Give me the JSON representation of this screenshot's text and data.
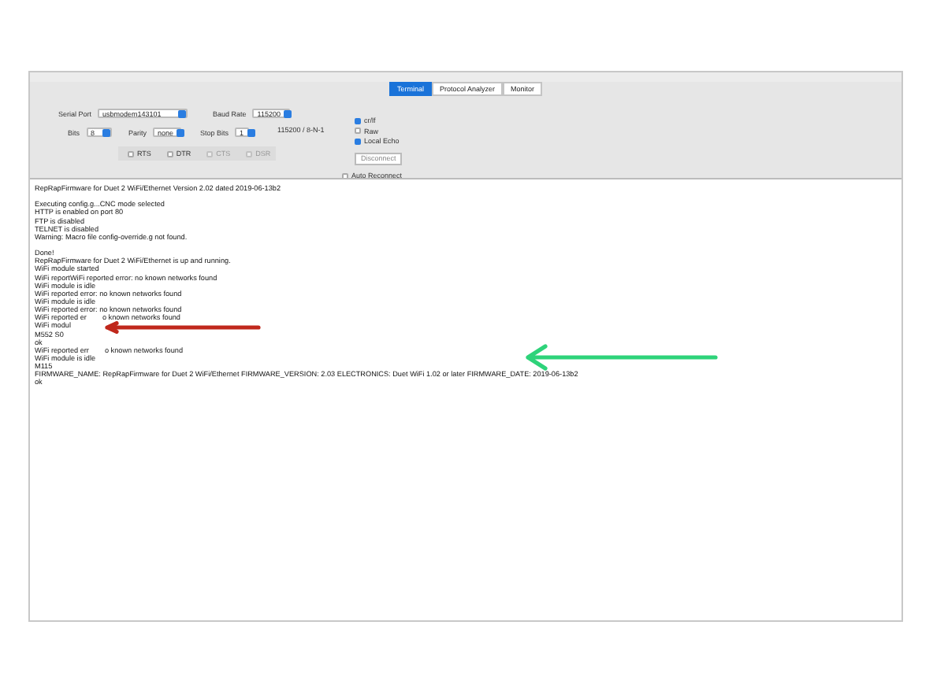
{
  "tabs": [
    {
      "label": "Terminal",
      "selected": true
    },
    {
      "label": "Protocol Analyzer",
      "selected": false
    },
    {
      "label": "Monitor",
      "selected": false
    }
  ],
  "serial_port": {
    "label": "Serial Port",
    "value": "usbmodem143101"
  },
  "baud_rate": {
    "label": "Baud Rate",
    "value": "115200"
  },
  "bits": {
    "label": "Bits",
    "value": "8"
  },
  "parity": {
    "label": "Parity",
    "value": "none"
  },
  "stop_bits": {
    "label": "Stop Bits",
    "value": "1"
  },
  "summary": "115200 / 8-N-1",
  "line_signals": [
    {
      "label": "RTS",
      "checked": false,
      "disabled": false
    },
    {
      "label": "DTR",
      "checked": false,
      "disabled": false
    },
    {
      "label": "CTS",
      "checked": false,
      "disabled": true
    },
    {
      "label": "DSR",
      "checked": false,
      "disabled": true
    }
  ],
  "options": [
    {
      "label": "cr/lf",
      "checked": true
    },
    {
      "label": "Raw",
      "checked": false
    },
    {
      "label": "Local Echo",
      "checked": true
    }
  ],
  "disconnect_button": "Disconnect",
  "auto_reconnect": {
    "label": "Auto Reconnect",
    "checked": false
  },
  "terminal_blocks": [
    [
      [
        "RepRapFirmware for Duet 2 WiFi/Ethernet Version 2.02 dated 2019-06-13b2"
      ]
    ],
    [
      [
        "Executing config.g...CNC mode selected"
      ],
      [
        "HTTP is enabled on port 80"
      ],
      [
        "FTP is disabled"
      ],
      [
        "TELNET is disabled"
      ],
      [
        "Warning: Macro file config-override.g not found."
      ]
    ],
    [
      [
        "Done!"
      ],
      [
        "RepRapFirmware for Duet 2 WiFi/Ethernet is up and running."
      ],
      [
        "WiFi module started"
      ],
      [
        "WiFi reportWiFi reported error: no known networks found"
      ],
      [
        "WiFi module is idle"
      ],
      [
        "WiFi reported error: no known networks found"
      ],
      [
        "WiFi module is idle"
      ],
      [
        "WiFi reported error: no known networks found"
      ],
      [
        "WiFi reported er",
        "o known networks found"
      ],
      [
        "WiFi modul"
      ],
      [
        "M552 S0"
      ],
      [
        "ok"
      ],
      [
        "WiFi reported err",
        "o known networks found"
      ],
      [
        "WiFi module is idle"
      ],
      [
        "M115"
      ],
      [
        "FIRMWARE_NAME: RepRapFirmware for Duet 2 WiFi/Ethernet FIRMWARE_VERSION: 2.03 ELECTRONICS: Duet WiFi 1.02 or later FIRMWARE_DATE: 2019-06-13b2"
      ],
      [
        "ok"
      ]
    ]
  ]
}
